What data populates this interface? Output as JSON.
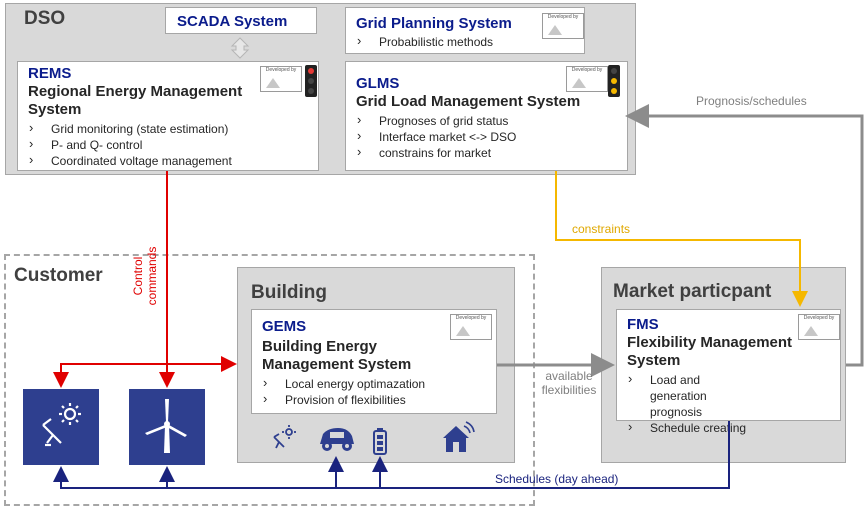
{
  "dso": {
    "title": "DSO",
    "scada": "SCADA System",
    "grid_planning": {
      "title": "Grid Planning System",
      "items": [
        "Probabilistic methods"
      ]
    },
    "rems": {
      "abbr": "REMS",
      "name_line1": "Regional Energy Management",
      "name_line2": "System",
      "items": [
        "Grid monitoring (state estimation)",
        "P- and Q- control",
        "Coordinated voltage management"
      ]
    },
    "glms": {
      "abbr": "GLMS",
      "name": "Grid Load Management System",
      "items": [
        "Prognoses of grid status",
        "Interface market <-> DSO",
        "constrains for market"
      ]
    }
  },
  "developed_by": "Developed by",
  "customer": {
    "title": "Customer"
  },
  "building": {
    "title": "Building",
    "gems": {
      "abbr": "GEMS",
      "name_line1": "Building Energy",
      "name_line2": "Management System",
      "items": [
        "Local energy optimazation",
        "Provision of flexibilities"
      ]
    }
  },
  "market": {
    "title": "Market particpant",
    "fms": {
      "abbr": "FMS",
      "name_line1": "Flexibility Management",
      "name_line2": "System",
      "items": [
        "Load and generation prognosis",
        "Schedule  creating"
      ]
    }
  },
  "labels": {
    "control_line1": "Control",
    "control_line2": "commands",
    "prognosis": "Prognosis/schedules",
    "constraints": "constraints",
    "available_line1": "available",
    "available_line2": "flexibilities",
    "schedules": "Schedules (day ahead)"
  },
  "icons": {
    "customer": [
      "solar-panel-icon",
      "wind-turbine-icon"
    ],
    "building": [
      "solar-panel-icon",
      "electric-car-icon",
      "battery-icon",
      "smart-home-icon"
    ]
  },
  "colors": {
    "control": "#e00000",
    "constraints": "#f5b800",
    "schedules": "#1a237e",
    "flow_gray": "#8c8c8c",
    "title_blue": "#0b1c8c",
    "tile_blue": "#2e3f8f"
  }
}
